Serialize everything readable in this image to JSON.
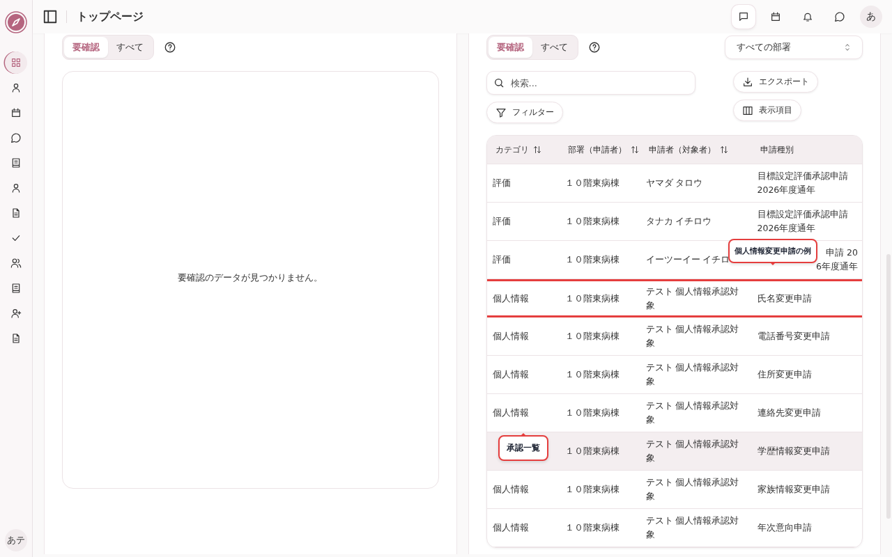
{
  "sidebar": {
    "items": [
      {
        "selected": true
      },
      {
        "selected": false
      },
      {
        "selected": false
      },
      {
        "selected": false
      },
      {
        "selected": false
      },
      {
        "selected": false
      },
      {
        "selected": false
      },
      {
        "selected": false
      },
      {
        "selected": false
      },
      {
        "selected": false
      },
      {
        "selected": false
      },
      {
        "selected": false
      }
    ],
    "avatar": "あテ"
  },
  "header": {
    "title": "トップページ",
    "icons": [
      {
        "selected": true
      },
      {
        "selected": false
      },
      {
        "selected": false
      },
      {
        "selected": false
      }
    ],
    "avatar": "あ"
  },
  "left_panel": {
    "tabs": [
      {
        "label": "要確認",
        "selected": true
      },
      {
        "label": "すべて",
        "selected": false
      }
    ],
    "empty_message": "要確認のデータが見つかりません。"
  },
  "right_panel": {
    "tabs": [
      {
        "label": "要確認",
        "selected": true
      },
      {
        "label": "すべて",
        "selected": false
      }
    ],
    "department_select": "すべての部署",
    "search": {
      "placeholder": "検索..."
    },
    "filter_button": "フィルター",
    "export_button": "エクスポート",
    "columns_button": "表示項目",
    "table": {
      "columns": [
        {
          "label": "カテゴリ",
          "sortable": true
        },
        {
          "label": "部署（申請者）",
          "sortable": true
        },
        {
          "label": "申請者（対象者）",
          "sortable": true
        },
        {
          "label": "申請種別",
          "sortable": false
        }
      ],
      "rows": [
        {
          "category": "評価",
          "department": "１０階東病棟",
          "applicant": "ヤマダ タロウ",
          "type": "目標設定評価承認申請 2026年度通年",
          "selected": false,
          "highlighted": false
        },
        {
          "category": "評価",
          "department": "１０階東病棟",
          "applicant": "タナカ イチロウ",
          "type": "目標設定評価承認申請 2026年度通年",
          "selected": false,
          "highlighted": false
        },
        {
          "category": "評価",
          "department": "１０階東病棟",
          "applicant": "イーツーイー イチロ",
          "type": "申請 20\n6年度通年",
          "selected": false,
          "highlighted": false
        },
        {
          "category": "個人情報",
          "department": "１０階東病棟",
          "applicant": "テスト 個人情報承認対象",
          "type": "氏名変更申請",
          "selected": false,
          "highlighted": true
        },
        {
          "category": "個人情報",
          "department": "１０階東病棟",
          "applicant": "テスト 個人情報承認対象",
          "type": "電話番号変更申請",
          "selected": false,
          "highlighted": false
        },
        {
          "category": "個人情報",
          "department": "１０階東病棟",
          "applicant": "テスト 個人情報承認対象",
          "type": "住所変更申請",
          "selected": false,
          "highlighted": false
        },
        {
          "category": "個人情報",
          "department": "１０階東病棟",
          "applicant": "テスト 個人情報承認対象",
          "type": "連絡先変更申請",
          "selected": false,
          "highlighted": false
        },
        {
          "department": "１０階東病棟",
          "applicant": "テスト 個人情報承認対象",
          "type": "学歴情報変更申請",
          "selected": true,
          "highlighted": false
        },
        {
          "category": "個人情報",
          "department": "１０階東病棟",
          "applicant": "テスト 個人情報承認対象",
          "type": "家族情報変更申請",
          "selected": false,
          "highlighted": false
        },
        {
          "category": "個人情報",
          "department": "１０階東病棟",
          "applicant": "テスト 個人情報承認対象",
          "type": "年次意向申請",
          "selected": false,
          "highlighted": false
        }
      ],
      "callouts": [
        {
          "text": "個人情報変更申請の例"
        },
        {
          "text": "承認一覧"
        }
      ]
    }
  }
}
